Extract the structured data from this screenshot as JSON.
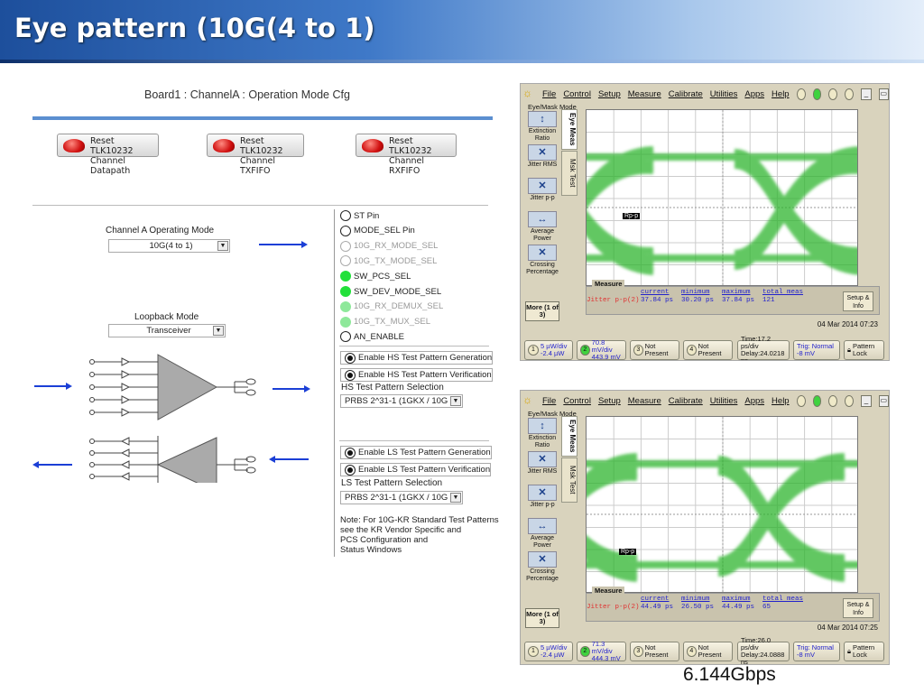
{
  "slide": {
    "title": "Eye pattern (10G(4 to 1)",
    "caption": "6.144Gbps"
  },
  "config": {
    "header": "Board1 : ChannelA : Operation Mode Cfg",
    "reset_buttons": [
      {
        "line1": "Reset TLK10232",
        "line2": "Channel Datapath"
      },
      {
        "line1": "Reset TLK10232",
        "line2": "Channel TXFIFO"
      },
      {
        "line1": "Reset TLK10232",
        "line2": "Channel RXFIFO"
      }
    ],
    "operating_mode": {
      "label": "Channel A Operating Mode",
      "value": "10G(4 to 1)"
    },
    "loopback_mode": {
      "label": "Loopback Mode",
      "value": "Transceiver"
    },
    "pins": [
      {
        "label": "ST Pin",
        "state": "off"
      },
      {
        "label": "MODE_SEL Pin",
        "state": "off"
      },
      {
        "label": "10G_RX_MODE_SEL",
        "state": "disabled"
      },
      {
        "label": "10G_TX_MODE_SEL",
        "state": "disabled"
      },
      {
        "label": "SW_PCS_SEL",
        "state": "on"
      },
      {
        "label": "SW_DEV_MODE_SEL",
        "state": "on"
      },
      {
        "label": "10G_RX_DEMUX_SEL",
        "state": "on-disabled"
      },
      {
        "label": "10G_TX_MUX_SEL",
        "state": "on-disabled"
      },
      {
        "label": "AN_ENABLE",
        "state": "off"
      }
    ],
    "hs": {
      "gen": "Enable HS Test Pattern Generation",
      "ver": "Enable HS Test Pattern Verification",
      "sel_label": "HS Test Pattern Selection",
      "sel_value": "PRBS 2^31-1 (1GKX / 10G"
    },
    "ls": {
      "gen": "Enable LS Test Pattern Generation",
      "ver": "Enable LS Test Pattern Verification",
      "sel_label": "LS Test Pattern Selection",
      "sel_value": "PRBS 2^31-1 (1GKX / 10G"
    },
    "note": [
      "Note: For 10G-KR Standard Test Patterns",
      "see the KR Vendor Specific and",
      "PCS Configuration and",
      "Status Windows"
    ]
  },
  "scopes": [
    {
      "menus": [
        "File",
        "Control",
        "Setup",
        "Measure",
        "Calibrate",
        "Utilities",
        "Apps",
        "Help"
      ],
      "mode": "Eye/Mask Mode",
      "left_buttons": [
        "Extinction Ratio",
        "Jitter RMS",
        "Jitter p-p",
        "Average Power",
        "Crossing Percentage"
      ],
      "more": "More (1 of 3)",
      "tabs": [
        "Eye Meas",
        "Msk Test"
      ],
      "marker": "Rp-p",
      "measure": {
        "title": "Measure",
        "label": "Jitter p-p(2)",
        "headers": [
          "current",
          "minimum",
          "maximum",
          "total meas"
        ],
        "values": [
          "37.84 ps",
          "30.20 ps",
          "37.84 ps",
          "121"
        ],
        "setup": "Setup & Info"
      },
      "datetime": "04 Mar 2014  07:23",
      "ch1": {
        "l1": "5 µW/div",
        "l2": "-2.4 µW"
      },
      "ch2": {
        "l1": "70.8 mV/div",
        "l2": "443.9 mV"
      },
      "ch3": "Not Present",
      "ch4": "Not Present",
      "time": {
        "l1": "Time:17.2 ps/div",
        "l2": "Delay:24.0218 ns"
      },
      "trig": {
        "l1": "Trig: Normal",
        "l2": "-8 mV"
      },
      "lock": "Pattern Lock"
    },
    {
      "menus": [
        "File",
        "Control",
        "Setup",
        "Measure",
        "Calibrate",
        "Utilities",
        "Apps",
        "Help"
      ],
      "mode": "Eye/Mask Mode",
      "left_buttons": [
        "Extinction Ratio",
        "Jitter RMS",
        "Jitter p-p",
        "Average Power",
        "Crossing Percentage"
      ],
      "more": "More (1 of 3)",
      "tabs": [
        "Eye Meas",
        "Msk Test"
      ],
      "marker": "Rp-p",
      "measure": {
        "title": "Measure",
        "label": "Jitter p-p(2)",
        "headers": [
          "current",
          "minimum",
          "maximum",
          "total meas"
        ],
        "values": [
          "44.49 ps",
          "26.50 ps",
          "44.49 ps",
          "65"
        ],
        "setup": "Setup & Info"
      },
      "datetime": "04 Mar 2014  07:25",
      "ch1": {
        "l1": "5 µW/div",
        "l2": "-2.4 µW"
      },
      "ch2": {
        "l1": "71.3 mV/div",
        "l2": "444.3 mV"
      },
      "ch3": "Not Present",
      "ch4": "Not Present",
      "time": {
        "l1": "Time:26.0 ps/div",
        "l2": "Delay:24.0888 ns"
      },
      "trig": {
        "l1": "Trig: Normal",
        "l2": "-8 mV"
      },
      "lock": "Pattern Lock"
    }
  ],
  "colors": {
    "eye": "#2fb52f",
    "accent": "#1b3fd6",
    "header_line": "#5b8fd0"
  }
}
